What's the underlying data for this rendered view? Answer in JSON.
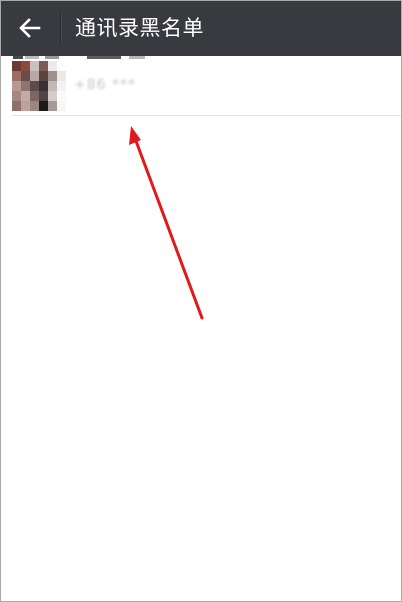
{
  "topbar": {
    "title": "通讯录黑名单",
    "back_icon": "arrow-left-icon",
    "background_color": "#393a3f"
  },
  "blacklist": {
    "items": [
      {
        "number": "+86 ***",
        "avatar_icon": "contact-avatar"
      }
    ]
  },
  "annotation": {
    "shape": "arrow",
    "color": "#e0191c"
  }
}
